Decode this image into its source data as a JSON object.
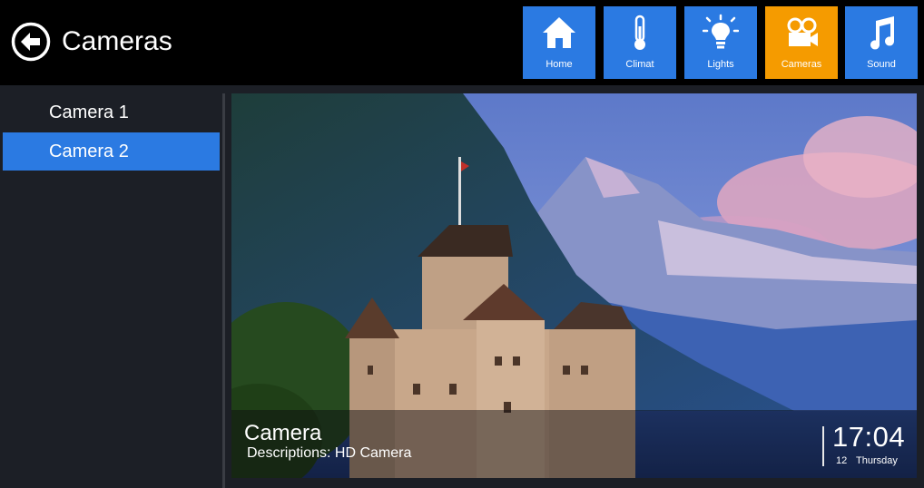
{
  "header": {
    "title": "Cameras",
    "back_icon": "back-arrow-icon"
  },
  "nav": {
    "tiles": [
      {
        "label": "Home",
        "icon": "home-icon",
        "active": false
      },
      {
        "label": "Climat",
        "icon": "thermometer-icon",
        "active": false
      },
      {
        "label": "Lights",
        "icon": "lightbulb-icon",
        "active": false
      },
      {
        "label": "Cameras",
        "icon": "camera-icon",
        "active": true
      },
      {
        "label": "Sound",
        "icon": "music-note-icon",
        "active": false
      }
    ],
    "colors": {
      "tile": "#2b7ae2",
      "active": "#f59b00"
    }
  },
  "sidebar": {
    "items": [
      {
        "label": "Camera 1",
        "selected": false
      },
      {
        "label": "Camera 2",
        "selected": true
      }
    ]
  },
  "feed": {
    "name": "Camera",
    "description": "Descriptions: HD Camera",
    "clock": {
      "time": "17:04",
      "day": "12",
      "weekday": "Thursday"
    }
  }
}
